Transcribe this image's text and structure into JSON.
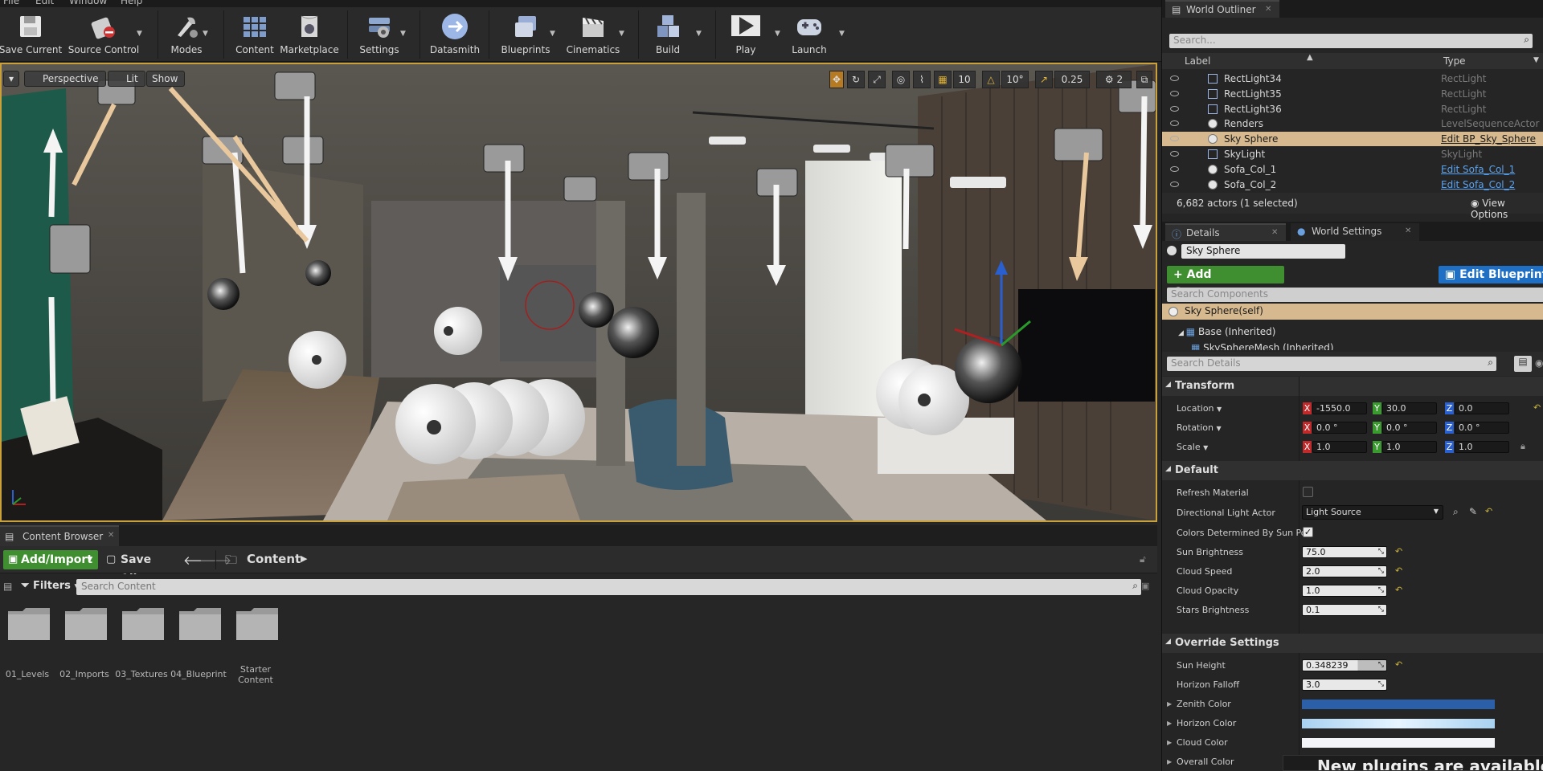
{
  "menu": {
    "items": [
      "File",
      "Edit",
      "Window",
      "Help"
    ]
  },
  "toolbar": {
    "buttons": [
      {
        "label": "Save Current"
      },
      {
        "label": "Source Control"
      },
      {
        "label": "Modes"
      },
      {
        "label": "Content"
      },
      {
        "label": "Marketplace"
      },
      {
        "label": "Settings"
      },
      {
        "label": "Datasmith"
      },
      {
        "label": "Blueprints"
      },
      {
        "label": "Cinematics"
      },
      {
        "label": "Build"
      },
      {
        "label": "Play"
      },
      {
        "label": "Launch"
      }
    ]
  },
  "viewport": {
    "view_mode": "Perspective",
    "lighting_mode": "Lit",
    "show_label": "Show",
    "grid_snap": "10",
    "rotation_snap": "10°",
    "scale_snap": "0.25",
    "camera_speed": "2"
  },
  "content_browser": {
    "tab_label": "Content Browser",
    "add_import": "Add/Import",
    "save_all": "Save All",
    "path_root": "Content",
    "filters": "Filters",
    "search_placeholder": "Search Content",
    "folders": [
      {
        "name": "01_Levels"
      },
      {
        "name": "02_Imports"
      },
      {
        "name": "03_Textures"
      },
      {
        "name": "04_Blueprint"
      },
      {
        "name": "Starter Content"
      }
    ]
  },
  "outliner": {
    "tab_label": "World Outliner",
    "search_placeholder": "Search...",
    "col_label": "Label",
    "col_type": "Type",
    "rows": [
      {
        "label": "RectLight34",
        "type": "RectLight",
        "selected": false,
        "link": false
      },
      {
        "label": "RectLight35",
        "type": "RectLight",
        "selected": false,
        "link": false
      },
      {
        "label": "RectLight36",
        "type": "RectLight",
        "selected": false,
        "link": false
      },
      {
        "label": "Renders",
        "type": "LevelSequenceActor",
        "selected": false,
        "link": false
      },
      {
        "label": "Sky Sphere",
        "type": "Edit BP_Sky_Sphere",
        "selected": true,
        "link": true
      },
      {
        "label": "SkyLight",
        "type": "SkyLight",
        "selected": false,
        "link": false
      },
      {
        "label": "Sofa_Col_1",
        "type": "Edit Sofa_Col_1",
        "selected": false,
        "link": true
      },
      {
        "label": "Sofa_Col_2",
        "type": "Edit Sofa_Col_2",
        "selected": false,
        "link": true
      }
    ],
    "actor_count": "6,682 actors (1 selected)",
    "view_options": "View Options"
  },
  "details": {
    "tab_details": "Details",
    "tab_world_settings": "World Settings",
    "actor_name": "Sky Sphere",
    "add_component": "Add Component",
    "edit_blueprint": "Edit Blueprint",
    "search_components": "Search Components",
    "component_self": "Sky Sphere(self)",
    "component_base": "Base (Inherited)",
    "component_mesh": "SkySphereMesh (Inherited)",
    "search_details": "Search Details",
    "transform": {
      "title": "Transform",
      "location_label": "Location",
      "rotation_label": "Rotation",
      "scale_label": "Scale",
      "location": {
        "x": "-1550.0",
        "y": "30.0",
        "z": "0.0"
      },
      "rotation": {
        "x": "0.0 °",
        "y": "0.0 °",
        "z": "0.0 °"
      },
      "scale": {
        "x": "1.0",
        "y": "1.0",
        "z": "1.0"
      }
    },
    "default": {
      "title": "Default",
      "refresh_material": "Refresh Material",
      "directional_light_actor": "Directional Light Actor",
      "directional_light_value": "Light Source",
      "colors_determined": "Colors Determined By Sun Po",
      "sun_brightness_label": "Sun Brightness",
      "sun_brightness": "75.0",
      "cloud_speed_label": "Cloud Speed",
      "cloud_speed": "2.0",
      "cloud_opacity_label": "Cloud Opacity",
      "cloud_opacity": "1.0",
      "stars_brightness_label": "Stars Brightness",
      "stars_brightness": "0.1"
    },
    "override": {
      "title": "Override Settings",
      "sun_height_label": "Sun Height",
      "sun_height": "0.348239",
      "horizon_falloff_label": "Horizon Falloff",
      "horizon_falloff": "3.0",
      "zenith_color_label": "Zenith Color",
      "horizon_color_label": "Horizon Color",
      "cloud_color_label": "Cloud Color",
      "overall_color_label": "Overall Color"
    }
  },
  "notification": "New plugins are available",
  "colors": {
    "accent_gold": "#c8a13c",
    "selection": "#d6b98f",
    "green_button": "#3f8f31",
    "blue_button": "#1f6fc5",
    "link": "#5aa2ee",
    "zenith": "#2b5fa8",
    "horizon": "#b8dcf6",
    "cloud": "#f2f4f8"
  }
}
